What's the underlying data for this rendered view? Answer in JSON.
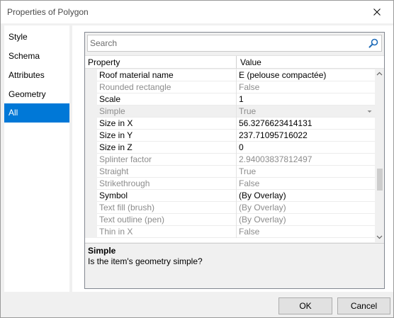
{
  "window": {
    "title": "Properties of Polygon"
  },
  "tabs": [
    {
      "label": "Style"
    },
    {
      "label": "Schema"
    },
    {
      "label": "Attributes"
    },
    {
      "label": "Geometry"
    },
    {
      "label": "All",
      "selected": true
    }
  ],
  "search": {
    "placeholder": "Search",
    "value": ""
  },
  "grid": {
    "column_property": "Property",
    "column_value": "Value",
    "rows": [
      {
        "name": "Roof material name",
        "value": "E (pelouse compactée)",
        "enabled": true
      },
      {
        "name": "Rounded rectangle",
        "value": "False",
        "enabled": false
      },
      {
        "name": "Scale",
        "value": "1",
        "enabled": true
      },
      {
        "name": "Simple",
        "value": "True",
        "enabled": false,
        "selected": true,
        "has_dropdown": true
      },
      {
        "name": "Size in X",
        "value": "56.3276623414131",
        "enabled": true
      },
      {
        "name": "Size in Y",
        "value": "237.71095716022",
        "enabled": true
      },
      {
        "name": "Size in Z",
        "value": "0",
        "enabled": true
      },
      {
        "name": "Splinter factor",
        "value": "2.94003837812497",
        "enabled": false
      },
      {
        "name": "Straight",
        "value": "True",
        "enabled": false
      },
      {
        "name": "Strikethrough",
        "value": "False",
        "enabled": false
      },
      {
        "name": "Symbol",
        "value": " (By Overlay)",
        "enabled": true
      },
      {
        "name": "Text fill (brush)",
        "value": " (By Overlay)",
        "enabled": false
      },
      {
        "name": "Text outline (pen)",
        "value": " (By Overlay)",
        "enabled": false
      },
      {
        "name": "Thin in X",
        "value": "False",
        "enabled": false
      }
    ]
  },
  "description": {
    "title": "Simple",
    "text": "Is the item's geometry simple?"
  },
  "buttons": {
    "ok": "OK",
    "cancel": "Cancel"
  },
  "colors": {
    "accent": "#0078d7",
    "disabled_text": "#8c8c8c"
  }
}
